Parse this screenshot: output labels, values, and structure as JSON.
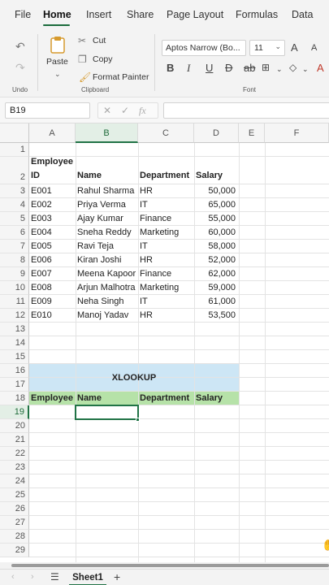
{
  "menu": {
    "tabs": [
      "File",
      "Home",
      "Insert",
      "Share",
      "Page Layout",
      "Formulas",
      "Data"
    ],
    "active": "Home"
  },
  "ribbon": {
    "undo_group_label": "Undo",
    "paste_label": "Paste",
    "cut_label": "Cut",
    "copy_label": "Copy",
    "format_painter_label": "Format Painter",
    "clipboard_group_label": "Clipboard",
    "font_name": "Aptos Narrow (Bo...",
    "font_size": "11",
    "font_group_label": "Font",
    "grow_label": "A",
    "shrink_label": "A"
  },
  "formula_bar": {
    "name_box": "B19",
    "fx_label": "fx",
    "formula": ""
  },
  "grid": {
    "columns": [
      "A",
      "B",
      "C",
      "D",
      "E",
      "F"
    ],
    "selected_column": "B",
    "selected_row": "19",
    "rows": [
      "1",
      "2",
      "3",
      "4",
      "5",
      "6",
      "7",
      "8",
      "9",
      "10",
      "11",
      "12",
      "13",
      "14",
      "15",
      "16",
      "17",
      "18",
      "19",
      "20",
      "21",
      "22",
      "23",
      "24",
      "25",
      "26",
      "27",
      "28",
      "29"
    ],
    "header_row": {
      "id_line1": "Employee",
      "id_line2": "ID",
      "name": "Name",
      "department": "Department",
      "salary": "Salary"
    },
    "employees": [
      {
        "id": "E001",
        "name": "Rahul Sharma",
        "department": "HR",
        "salary": "50,000"
      },
      {
        "id": "E002",
        "name": "Priya Verma",
        "department": "IT",
        "salary": "65,000"
      },
      {
        "id": "E003",
        "name": "Ajay Kumar",
        "department": "Finance",
        "salary": "55,000"
      },
      {
        "id": "E004",
        "name": "Sneha Reddy",
        "department": "Marketing",
        "salary": "60,000"
      },
      {
        "id": "E005",
        "name": "Ravi Teja",
        "department": "IT",
        "salary": "58,000"
      },
      {
        "id": "E006",
        "name": "Kiran Joshi",
        "department": "HR",
        "salary": "52,000"
      },
      {
        "id": "E007",
        "name": "Meena Kapoor",
        "department": "Finance",
        "salary": "62,000"
      },
      {
        "id": "E008",
        "name": "Arjun Malhotra",
        "department": "Marketing",
        "salary": "59,000"
      },
      {
        "id": "E009",
        "name": "Neha Singh",
        "department": "IT",
        "salary": "61,000"
      },
      {
        "id": "E010",
        "name": "Manoj Yadav",
        "department": "HR",
        "salary": "53,500"
      }
    ],
    "xlookup_title": "XLOOKUP",
    "lookup_header": {
      "id": "Employee I",
      "name": "Name",
      "department": "Department",
      "salary": "Salary"
    },
    "band_colors": {
      "title": "#cde6f5",
      "header": "#b6e2a8"
    }
  },
  "sheets": {
    "tabs": [
      "Sheet1"
    ],
    "add_label": "+"
  },
  "colors": {
    "accent": "#217346"
  }
}
